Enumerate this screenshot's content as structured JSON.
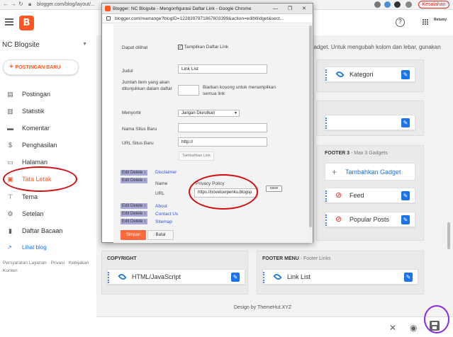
{
  "browser": {
    "url": "blogger.com/blog/layout/...",
    "error_label": "Kesalahan"
  },
  "header": {
    "logo": "B"
  },
  "sidebar": {
    "blog_name": "NC Blogsite",
    "new_post": "POSTINGAN BARU",
    "items": [
      {
        "label": "Postingan",
        "icon": "post-icon"
      },
      {
        "label": "Statistik",
        "icon": "stats-icon"
      },
      {
        "label": "Komentar",
        "icon": "comment-icon"
      },
      {
        "label": "Penghasilan",
        "icon": "dollar-icon"
      },
      {
        "label": "Halaman",
        "icon": "page-icon"
      },
      {
        "label": "Tata Letak",
        "icon": "layout-icon"
      },
      {
        "label": "Tema",
        "icon": "theme-icon"
      },
      {
        "label": "Setelan",
        "icon": "gear-icon"
      },
      {
        "label": "Daftar Bacaan",
        "icon": "bookmark-icon"
      }
    ],
    "view_blog": "Lihat blog",
    "footer_links": "Persyaratan Layanan · Privasi · Kebijakan Konten"
  },
  "layout": {
    "description": "gadget. Untuk mengubah kolom dan lebar, gunakan",
    "gadget_kategori": "Kategori",
    "footer3_title": "FOOTER 3",
    "footer3_sub": "- Max 3 Gadgets",
    "add_gadget": "Tambahkan Gadget",
    "gadget_feed": "Feed",
    "gadget_popular": "Popular Posts",
    "copyright_title": "COPYRIGHT",
    "gadget_html": "HTML/JavaScript",
    "footer_menu_title": "FOOTER MENU",
    "footer_menu_sub": "- Footer Links",
    "gadget_linklist": "Link List",
    "design_by": "Design by ThemeHut.XYZ"
  },
  "popup": {
    "title": "Blogger: NC Blogsite - Mengonfigurasi Daftar Link - Google Chrome",
    "url": "blogger.com/rearrange?blogID=1228397971867603399&action=editWidget&sect...",
    "dapat_dilihat": "Dapat dilihat",
    "tampilkan": "Tampilkan Daftar Link",
    "judul_label": "Judul",
    "judul_value": "Link List",
    "jumlah_label": "Jumlah item yang akan ditunjukkan dalam daftar",
    "jumlah_hint": "Biarkan kosong untuk menampilkan semua link",
    "menyortir_label": "Menyortir",
    "menyortir_value": "Jangan Diurutkan",
    "nama_situs_label": "Nama Situs Baru",
    "url_situs_label": "URL Situs Baru",
    "url_situs_value": "http://",
    "tambahkan_link": "Tambahkan Link",
    "edit_delete": "Edit Delete",
    "link_disclaimer": "Disclaimer",
    "name_label": "Name",
    "name_value": "Privacy Policy",
    "url_label": "URL",
    "url_value": "https://novelcerpenku.blogsp",
    "save_label": "save",
    "link_about": "About",
    "link_contact": "Contact Us",
    "link_sitemap": "Sitemap",
    "simpan": "Simpan",
    "batal": "Batal"
  },
  "colors": {
    "accent": "#ff5722",
    "link": "#1a73e8",
    "highlight_red": "#d01010",
    "highlight_purple": "#8a2be2"
  }
}
